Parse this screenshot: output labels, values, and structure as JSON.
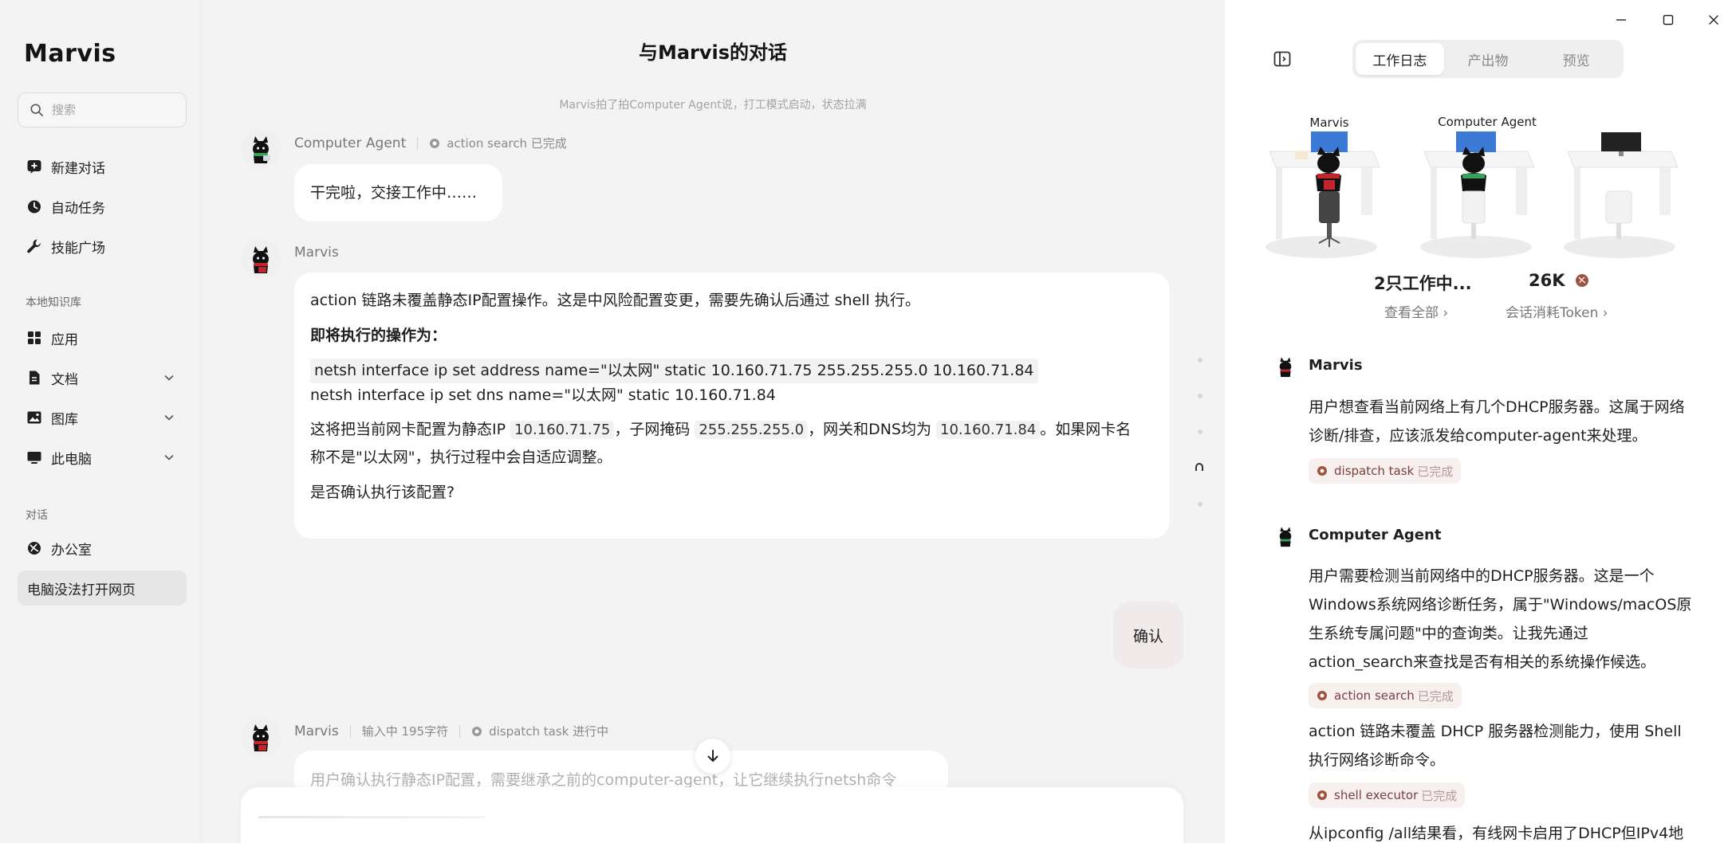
{
  "app": {
    "brand": "Marvis"
  },
  "sidebar": {
    "search_placeholder": "搜索",
    "top_items": [
      {
        "label": "新建对话",
        "icon": "new-chat-icon"
      },
      {
        "label": "自动任务",
        "icon": "clock-icon"
      },
      {
        "label": "技能广场",
        "icon": "wrench-icon"
      }
    ],
    "kb_label": "本地知识库",
    "kb_items": [
      {
        "label": "应用",
        "icon": "apps-grid-icon"
      },
      {
        "label": "文档",
        "icon": "document-icon"
      },
      {
        "label": "图库",
        "icon": "image-icon"
      },
      {
        "label": "此电脑",
        "icon": "monitor-icon"
      }
    ],
    "conv_label": "对话",
    "conv_items": [
      {
        "label": "办公室",
        "icon": "office-icon"
      },
      {
        "label": "电脑没法打开网页"
      }
    ]
  },
  "conversation": {
    "title": "与Marvis的对话",
    "system_note": "Marvis拍了拍Computer Agent说，打工模式启动，状态拉满",
    "msg1": {
      "sender": "Computer Agent",
      "status_name": "action search",
      "status_state": "已完成",
      "text": "干完啦，交接工作中……"
    },
    "msg2": {
      "sender": "Marvis",
      "line1": "action 链路未覆盖静态IP配置操作。这是中风险配置变更，需要先确认后通过 shell 执行。",
      "heading": "即将执行的操作为：",
      "code1": "netsh interface ip set address name=\"以太网\" static 10.160.71.75 255.255.255.0 10.160.71.84",
      "code2": "netsh interface ip set dns name=\"以太网\" static 10.160.71.84",
      "p3_a": "这将把当前网卡配置为静态IP ",
      "ip": "10.160.71.75",
      "p3_b": "，子网掩码 ",
      "mask": "255.255.255.0",
      "p3_c": "，网关和DNS均为 ",
      "gw": "10.160.71.84",
      "p3_d": "。如果网卡名",
      "p3_e": "称不是\"以太网\"，执行过程中会自适应调整。",
      "question": "是否确认执行该配置?"
    },
    "user_msg": "确认",
    "msg3": {
      "sender": "Marvis",
      "typing": "输入中 195字符",
      "status_name": "dispatch task",
      "status_state": "进行中",
      "preview": "用户确认执行静态IP配置，需要继承之前的computer-agent，让它继续执行netsh命令"
    }
  },
  "panel": {
    "tabs": [
      "工作日志",
      "产出物",
      "预览"
    ],
    "active_tab": 0,
    "stations": [
      {
        "label": "Marvis"
      },
      {
        "label": "Computer Agent"
      },
      {
        "label": ""
      }
    ],
    "working_count": "2只工作中...",
    "view_all": "查看全部",
    "tokens": "26K",
    "tokens_link": "会话消耗Token",
    "log": [
      {
        "name": "Marvis",
        "lines": [
          "用户想查看当前网络上有几个DHCP服务器。这属于网络",
          "诊断/排查，应该派发给computer-agent来处理。"
        ],
        "chip": "dispatch task",
        "chip_state": "已完成"
      },
      {
        "name": "Computer Agent",
        "lines": [
          "用户需要检测当前网络中的DHCP服务器。这是一个",
          "Windows系统网络诊断任务，属于\"Windows/macOS原",
          "生系统专属问题\"中的查询类。让我先通过",
          "action_search来查找是否有相关的系统操作候选。"
        ],
        "chip": "action search",
        "chip_state": "已完成"
      },
      {
        "lines": [
          "action 链路未覆盖 DHCP 服务器检测能力，使用 Shell",
          "执行网络诊断命令。"
        ],
        "chip": "shell executor",
        "chip_state": "已完成"
      },
      {
        "lines": [
          "从ipconfig /all结果看，有线网卡启用了DHCP但IPv4地"
        ]
      }
    ]
  },
  "colors": {
    "accent_red": "#8b3a3a",
    "chip_bg": "#f7f0ef",
    "user_bubble": "#f0ebea"
  }
}
